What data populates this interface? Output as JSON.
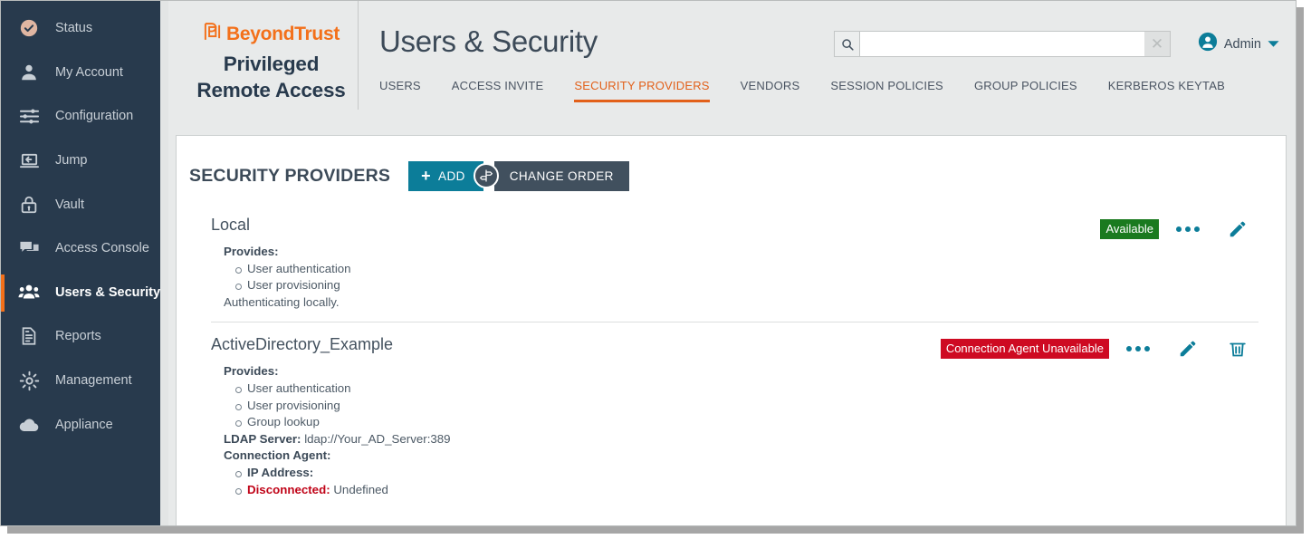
{
  "sidebar": {
    "items": [
      {
        "label": "Status",
        "icon": "check-circle-icon",
        "active": false
      },
      {
        "label": "My Account",
        "icon": "user-icon",
        "active": false
      },
      {
        "label": "Configuration",
        "icon": "sliders-icon",
        "active": false
      },
      {
        "label": "Jump",
        "icon": "jump-laptop-icon",
        "active": false
      },
      {
        "label": "Vault",
        "icon": "lock-icon",
        "active": false
      },
      {
        "label": "Access Console",
        "icon": "chat-bubbles-icon",
        "active": false
      },
      {
        "label": "Users & Security",
        "icon": "users-group-icon",
        "active": true
      },
      {
        "label": "Reports",
        "icon": "report-document-icon",
        "active": false
      },
      {
        "label": "Management",
        "icon": "gear-icon",
        "active": false
      },
      {
        "label": "Appliance",
        "icon": "cloud-icon",
        "active": false
      }
    ]
  },
  "brand": {
    "wordmark": "BeyondTrust",
    "product_line1": "Privileged",
    "product_line2": "Remote Access",
    "logo_color": "#f3701a"
  },
  "header": {
    "page_title": "Users & Security",
    "tabs": [
      {
        "label": "USERS",
        "active": false
      },
      {
        "label": "ACCESS INVITE",
        "active": false
      },
      {
        "label": "SECURITY PROVIDERS",
        "active": true
      },
      {
        "label": "VENDORS",
        "active": false
      },
      {
        "label": "SESSION POLICIES",
        "active": false
      },
      {
        "label": "GROUP POLICIES",
        "active": false
      },
      {
        "label": "KERBEROS KEYTAB",
        "active": false
      }
    ],
    "active_tab_color": "#e2601a",
    "search": {
      "value": "",
      "placeholder": "",
      "icon": "search-icon",
      "clear_icon": "close-icon"
    },
    "account": {
      "name": "Admin",
      "icon": "user-avatar-icon",
      "caret": "chevron-down-icon"
    }
  },
  "toolbar": {
    "section_title": "SECURITY PROVIDERS",
    "add_label": "ADD",
    "add_plus": "+",
    "add_color": "#0c7d99",
    "guide_icon": "signpost-icon",
    "change_order_label": "CHANGE ORDER",
    "change_order_color": "#41505e"
  },
  "providers": [
    {
      "name": "Local",
      "provides_label": "Provides:",
      "provides": [
        "User authentication",
        "User provisioning"
      ],
      "note": "Authenticating locally.",
      "status": {
        "text": "Available",
        "color": "#1a7a1f"
      },
      "actions": [
        "more-options-icon",
        "edit-pencil-icon"
      ]
    },
    {
      "name": "ActiveDirectory_Example",
      "provides_label": "Provides:",
      "provides": [
        "User authentication",
        "User provisioning",
        "Group lookup"
      ],
      "ldap_label": "LDAP Server:",
      "ldap_value": "ldap://Your_AD_Server:389",
      "agent_label": "Connection Agent:",
      "ip_label": "IP Address:",
      "ip_value": "",
      "disconnected_label": "Disconnected:",
      "disconnected_value": "Undefined",
      "status": {
        "text": "Connection Agent Unavailable",
        "color": "#ce0a22"
      },
      "actions": [
        "more-options-icon",
        "edit-pencil-icon",
        "delete-trash-icon"
      ]
    }
  ]
}
